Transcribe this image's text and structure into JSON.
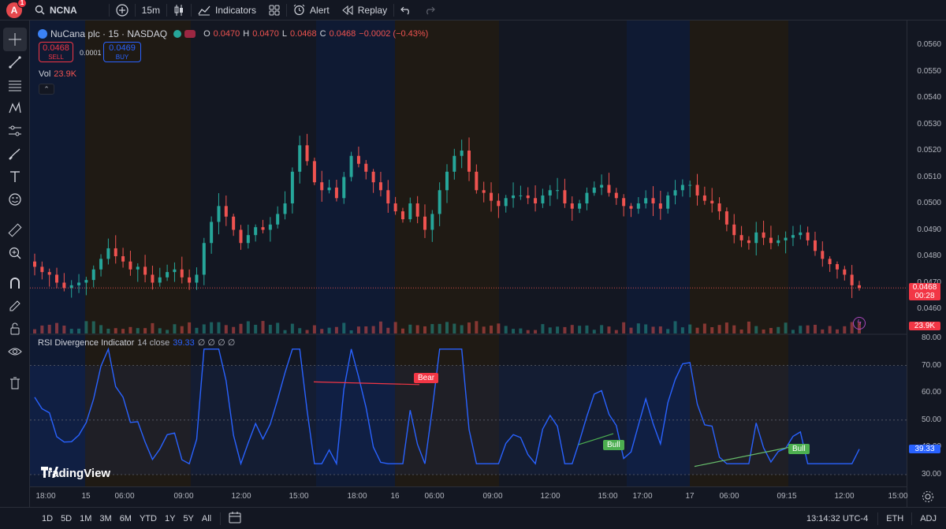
{
  "topbar": {
    "avatar_letter": "A",
    "notif_count": "1",
    "symbol": "NCNA",
    "interval": "15m",
    "indicators_label": "Indicators",
    "alert_label": "Alert",
    "replay_label": "Replay"
  },
  "legend": {
    "title": "NuCana plc · 15 · NASDAQ",
    "o_label": "O",
    "o": "0.0470",
    "h_label": "H",
    "h": "0.0470",
    "l_label": "L",
    "l": "0.0468",
    "c_label": "C",
    "c": "0.0468",
    "change": "−0.0002 (−0.43%)",
    "sell_price": "0.0468",
    "sell_label": "SELL",
    "spread": "0.0001",
    "buy_price": "0.0469",
    "buy_label": "BUY",
    "vol_label": "Vol",
    "vol_value": "23.9K"
  },
  "rsi_legend": {
    "name": "RSI Divergence Indicator",
    "params": "14 close",
    "value": "39.33",
    "extra": "∅ ∅ ∅ ∅"
  },
  "price_axis": [
    "0.0560",
    "0.0550",
    "0.0540",
    "0.0530",
    "0.0520",
    "0.0510",
    "0.0500",
    "0.0490",
    "0.0480",
    "0.0470",
    "0.0460"
  ],
  "price_tag": {
    "price": "0.0468",
    "countdown": "00:28"
  },
  "vol_tag": "23.9K",
  "rsi_axis": [
    "80.00",
    "70.00",
    "60.00",
    "50.00",
    "40.00",
    "30.00"
  ],
  "rsi_tag": "39.33",
  "time_axis": [
    "18:00",
    "15",
    "06:00",
    "09:00",
    "12:00",
    "15:00",
    "18:00",
    "16",
    "06:00",
    "09:00",
    "12:00",
    "15:00",
    "17:00",
    "17",
    "06:00",
    "09:15",
    "12:00",
    "15:00"
  ],
  "divergence_labels": {
    "bear": "Bear",
    "bull1": "Bull",
    "bull2": "Bull"
  },
  "brand": "TradingView",
  "bottombar": {
    "ranges": [
      "1D",
      "5D",
      "1M",
      "3M",
      "6M",
      "YTD",
      "1Y",
      "5Y",
      "All"
    ],
    "clock": "13:14:32 UTC-4",
    "session": "ETH",
    "adj": "ADJ"
  },
  "colors": {
    "up": "#26a69a",
    "down": "#ef5350",
    "rsi": "#2962ff",
    "bg": "#131722"
  },
  "chart_data": {
    "type": "candlestick+volume+rsi",
    "symbol": "NCNA",
    "candles_close": [
      0.0476,
      0.0474,
      0.0473,
      0.047,
      0.0468,
      0.0469,
      0.047,
      0.0471,
      0.0475,
      0.0479,
      0.0483,
      0.048,
      0.0478,
      0.0475,
      0.0476,
      0.0473,
      0.047,
      0.0472,
      0.0474,
      0.0475,
      0.0472,
      0.047,
      0.0473,
      0.0485,
      0.0493,
      0.0499,
      0.0495,
      0.049,
      0.0485,
      0.0488,
      0.0491,
      0.049,
      0.0492,
      0.0496,
      0.05,
      0.0512,
      0.0522,
      0.0516,
      0.0508,
      0.0505,
      0.0506,
      0.0502,
      0.051,
      0.0518,
      0.0515,
      0.0512,
      0.0508,
      0.0505,
      0.05,
      0.0497,
      0.0494,
      0.05,
      0.0495,
      0.049,
      0.0496,
      0.0505,
      0.0512,
      0.0518,
      0.052,
      0.0512,
      0.0505,
      0.0504,
      0.0501,
      0.0499,
      0.0502,
      0.0503,
      0.0503,
      0.0502,
      0.05,
      0.0503,
      0.0505,
      0.0505,
      0.05,
      0.0498,
      0.05,
      0.0504,
      0.0506,
      0.0507,
      0.0504,
      0.0502,
      0.0499,
      0.0498,
      0.05,
      0.0502,
      0.05,
      0.0498,
      0.0503,
      0.0505,
      0.0507,
      0.0507,
      0.0503,
      0.0501,
      0.05,
      0.0497,
      0.0492,
      0.0488,
      0.0486,
      0.0485,
      0.0489,
      0.0487,
      0.0485,
      0.0486,
      0.0487,
      0.0488,
      0.0489,
      0.0486,
      0.0482,
      0.0479,
      0.0477,
      0.0475,
      0.0473,
      0.0469,
      0.0468
    ]
  }
}
